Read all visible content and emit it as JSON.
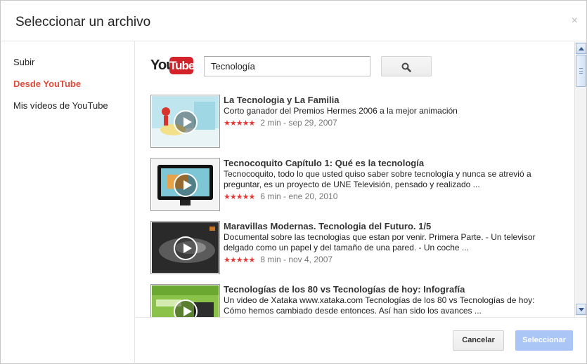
{
  "dialog": {
    "title": "Seleccionar un archivo",
    "close_symbol": "×"
  },
  "sidebar": {
    "items": [
      {
        "label": "Subir",
        "active": false
      },
      {
        "label": "Desde YouTube",
        "active": true
      },
      {
        "label": "Mis vídeos de YouTube",
        "active": false
      }
    ]
  },
  "search": {
    "logo_you": "You",
    "logo_tube": "Tube",
    "query": "Tecnología",
    "button_icon": "search-icon"
  },
  "results": [
    {
      "title": "La Tecnologia y La Familia",
      "description": "Corto ganador del Premios Hermes 2006 a la mejor animación",
      "stars": "★★★★★",
      "meta": "2 min - sep 29, 2007"
    },
    {
      "title": "Tecnocoquito Capítulo 1: Qué es la tecnología",
      "description": "Tecnocoquito, todo lo que usted quiso saber sobre tecnología y nunca se atrevió a preguntar, es un proyecto de UNE Televisión, pensado y realizado ...",
      "stars": "★★★★★",
      "meta": "6 min - ene 20, 2010"
    },
    {
      "title": "Maravillas Modernas. Tecnologia del Futuro. 1/5",
      "description": "Documental sobre las tecnologias que estan por venir. Primera Parte. - Un televisor delgado como un papel y del tamaño de una pared. - Un coche ...",
      "stars": "★★★★★",
      "meta": "8 min - nov 4, 2007"
    },
    {
      "title": "Tecnologías de los 80 vs Tecnologías de hoy: Infografía",
      "description": "Un video de Xataka www.xataka.com Tecnologías de los 80 vs Tecnologías de hoy: Cómo hemos cambiado desde entonces. Así han sido los avances ...",
      "stars": "★★★★★",
      "meta": ""
    }
  ],
  "footer": {
    "cancel_label": "Cancelar",
    "select_label": "Seleccionar"
  },
  "colors": {
    "active_nav": "#dd4b39",
    "stars": "#e53935",
    "youtube_red": "#d3222a",
    "select_button": "#a9c6f7"
  }
}
